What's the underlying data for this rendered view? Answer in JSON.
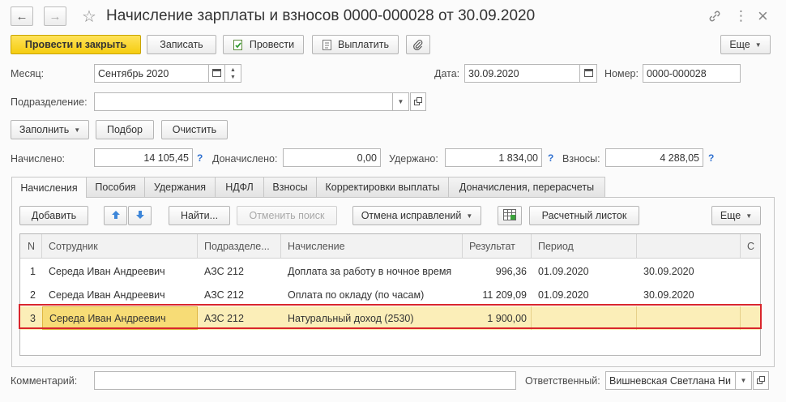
{
  "window": {
    "title": "Начисление зарплаты и взносов 0000-000028 от 30.09.2020",
    "nav_back": "←",
    "nav_forward": "→",
    "star": "☆",
    "link_icon": "link-icon",
    "more_icon": "⋮",
    "close": "×"
  },
  "toolbar": {
    "post_close": "Провести и закрыть",
    "save": "Записать",
    "post": "Провести",
    "pay": "Выплатить",
    "more": "Еще"
  },
  "header": {
    "month_label": "Месяц:",
    "month_value": "Сентябрь 2020",
    "date_label": "Дата:",
    "date_value": "30.09.2020",
    "number_label": "Номер:",
    "number_value": "0000-000028",
    "division_label": "Подразделение:",
    "division_value": ""
  },
  "actions": {
    "fill": "Заполнить",
    "select": "Подбор",
    "clear": "Очистить"
  },
  "totals": {
    "accrued_label": "Начислено:",
    "accrued_value": "14 105,45",
    "additional_label": "Доначислено:",
    "additional_value": "0,00",
    "withheld_label": "Удержано:",
    "withheld_value": "1 834,00",
    "contrib_label": "Взносы:",
    "contrib_value": "4 288,05",
    "help": "?"
  },
  "tabs": [
    "Начисления",
    "Пособия",
    "Удержания",
    "НДФЛ",
    "Взносы",
    "Корректировки выплаты",
    "Доначисления, перерасчеты"
  ],
  "table_toolbar": {
    "add": "Добавить",
    "find": "Найти...",
    "cancel_search": "Отменить поиск",
    "cancel_corrections": "Отмена исправлений",
    "payslip": "Расчетный листок",
    "more": "Еще"
  },
  "table": {
    "columns": [
      "N",
      "Сотрудник",
      "Подразделе...",
      "Начисление",
      "Результат",
      "Период",
      "",
      "С"
    ],
    "rows": [
      {
        "n": "1",
        "employee": "Середа Иван Андреевич",
        "division": "АЗС 212",
        "accrual": "Доплата за работу в ночное время",
        "result": "996,36",
        "period_from": "01.09.2020",
        "period_to": "30.09.2020"
      },
      {
        "n": "2",
        "employee": "Середа Иван Андреевич",
        "division": "АЗС 212",
        "accrual": "Оплата по окладу (по часам)",
        "result": "11 209,09",
        "period_from": "01.09.2020",
        "period_to": "30.09.2020"
      },
      {
        "n": "3",
        "employee": "Середа Иван Андреевич",
        "division": "АЗС 212",
        "accrual": "Натуральный доход (2530)",
        "result": "1 900,00",
        "period_from": "",
        "period_to": ""
      }
    ],
    "selected_row": 3
  },
  "footer": {
    "comment_label": "Комментарий:",
    "comment_value": "",
    "responsible_label": "Ответственный:",
    "responsible_value": "Вишневская Светлана Ни"
  },
  "colors": {
    "primary_button": "#f5cd10",
    "selected_row": "#fbeeb8",
    "selected_cell": "#f7dc76",
    "highlight_frame": "#d9262c",
    "link_blue": "#2e6fcf"
  }
}
